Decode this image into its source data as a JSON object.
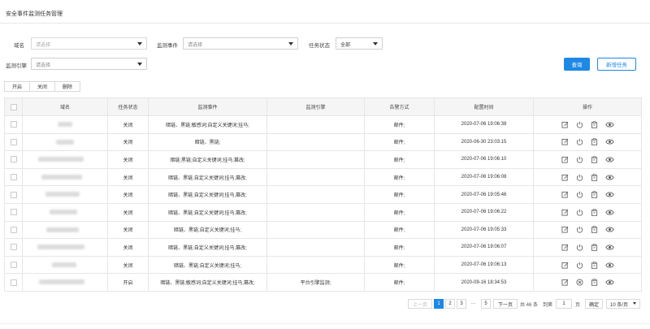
{
  "page": {
    "title": "安全事件监测任务管理"
  },
  "filters": {
    "domain_label": "域名",
    "domain_placeholder": "请选择",
    "event_label": "监测事件",
    "event_placeholder": "请选择",
    "status_label": "任务状态",
    "status_value": "全部",
    "engine_label": "监测引擎",
    "engine_placeholder": "请选择"
  },
  "buttons": {
    "query": "查询",
    "add_task": "新增任务"
  },
  "actions": {
    "enable": "开启",
    "close": "关闭",
    "delete": "删除"
  },
  "table": {
    "headers": [
      "域名",
      "任务状态",
      "监测事件",
      "监测引擎",
      "告警方式",
      "配置时间",
      "操作"
    ],
    "rows": [
      {
        "status": "关闭",
        "event": "暗链、黑链;敏感词;自定义关键词;挂马;",
        "engine": "",
        "alert": "邮件;",
        "time": "2020-07-06 19:06:38"
      },
      {
        "status": "关闭",
        "event": "暗链、黑链;",
        "engine": "",
        "alert": "邮件;",
        "time": "2020-06-30 23:03:15"
      },
      {
        "status": "关闭",
        "event": "暗链;黑链;自定义关键词;挂马;篡改;",
        "engine": "",
        "alert": "邮件;",
        "time": "2020-07-06 19:06:10"
      },
      {
        "status": "关闭",
        "event": "暗链、黑链;自定义关键词;挂马;篡改;",
        "engine": "",
        "alert": "邮件;",
        "time": "2020-07-06 19:06:08"
      },
      {
        "status": "关闭",
        "event": "暗链、黑链;自定义关键词;挂马;篡改;",
        "engine": "",
        "alert": "邮件;",
        "time": "2020-07-06 19:05:46"
      },
      {
        "status": "关闭",
        "event": "暗链、黑链;自定义关键词;挂马;篡改;",
        "engine": "",
        "alert": "邮件;",
        "time": "2020-07-06 19:06:22"
      },
      {
        "status": "关闭",
        "event": "暗链、黑链;自定义关键词;挂马;",
        "engine": "",
        "alert": "邮件;",
        "time": "2020-07-06 19:05:33"
      },
      {
        "status": "关闭",
        "event": "暗链、黑链;自定义关键词;挂马;篡改;",
        "engine": "",
        "alert": "邮件;",
        "time": "2020-07-06 19:06:07"
      },
      {
        "status": "关闭",
        "event": "暗链、黑链;自定义关键词;挂马;",
        "engine": "",
        "alert": "邮件;",
        "time": "2020-07-06 19:06:13"
      },
      {
        "status": "开启",
        "event": "暗链、黑链;敏感词;自定义关键词;挂马;篡改;",
        "engine": "平台引擎监测;",
        "alert": "邮件;",
        "time": "2020-09-16 18:34:53"
      }
    ]
  },
  "pagination": {
    "prev": "上一页",
    "pages": [
      "1",
      "2",
      "3"
    ],
    "ellipsis": "...",
    "last_page": "5",
    "next": "下一页",
    "total": "共 46 条",
    "goto_label": "到第",
    "goto_value": "1",
    "goto_suffix": "页",
    "confirm": "确定",
    "page_size": "10 条/页"
  },
  "colors": {
    "accent": "#1e88e5",
    "header_bg": "#f5f5f5",
    "border": "#e6e6e6"
  }
}
